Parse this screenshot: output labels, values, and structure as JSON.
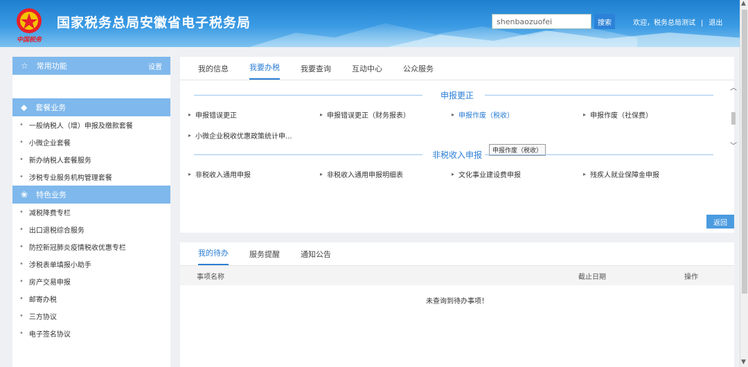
{
  "header": {
    "site_title": "国家税务总局安徽省电子税务局",
    "logo_script": "中国税务",
    "search_value": "shenbaozuofei",
    "search_button": "搜索",
    "welcome": "欢迎，税务总局测试",
    "sep": "|",
    "logout": "退出"
  },
  "sidebar": {
    "common": {
      "title": "常用功能",
      "action": "设置"
    },
    "hot": {
      "title": "套餐业务",
      "items": [
        "一般纳税人（增）申报及缴款套餐",
        "小微企业套餐",
        "新办纳税人套餐服务",
        "涉税专业服务机构管理套餐"
      ]
    },
    "special": {
      "title": "特色业务",
      "items": [
        "减税降费专栏",
        "出口退税综合服务",
        "防控新冠肺炎疫情税收优惠专栏",
        "涉税表单填报小助手",
        "房产交易申报",
        "邮寄办税",
        "三方协议",
        "电子签名协议"
      ]
    }
  },
  "main": {
    "tabs": [
      "我的信息",
      "我要办税",
      "我要查询",
      "互动中心",
      "公众服务"
    ],
    "active_tab": 1,
    "section1_title": "申报更正",
    "section1_items": [
      "申报错误更正",
      "申报错误更正（财务报表）",
      "申报作废（税收）",
      "申报作废（社保费）",
      "小微企业税收优惠政策统计申..."
    ],
    "tooltip": "申报作废（税收）",
    "section2_title": "非税收入申报",
    "section2_items": [
      "非税收入通用申报",
      "非税收入通用申报明细表",
      "文化事业建设费申报",
      "残疾人就业保障金申报"
    ],
    "back_button": "返回"
  },
  "bottom": {
    "tabs": [
      "我的待办",
      "服务提醒",
      "通知公告"
    ],
    "active_tab": 0,
    "columns": [
      "事项名称",
      "截止日期",
      "操作"
    ],
    "empty_message": "未查询到待办事项！"
  },
  "colors": {
    "header": "#2f8fe0",
    "accent": "#2a7dd4",
    "sidebar_head": "#7fb8ec"
  },
  "icons": {
    "common": "star-icon",
    "hot": "diamond-icon",
    "special": "clover-icon"
  }
}
